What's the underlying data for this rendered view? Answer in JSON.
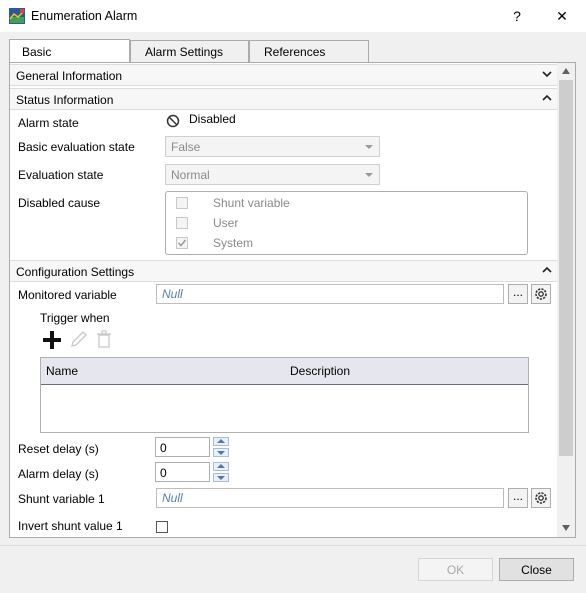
{
  "window": {
    "title": "Enumeration Alarm",
    "help": "?",
    "close": "✕"
  },
  "tabs": [
    {
      "label": "Basic"
    },
    {
      "label": "Alarm Settings"
    },
    {
      "label": "References"
    }
  ],
  "sections": {
    "general": "General Information",
    "status": "Status Information",
    "config": "Configuration Settings"
  },
  "status": {
    "alarm_state_label": "Alarm state",
    "alarm_state_value": "Disabled",
    "basic_eval_label": "Basic evaluation state",
    "basic_eval_value": "False",
    "eval_label": "Evaluation state",
    "eval_value": "Normal",
    "disabled_cause_label": "Disabled cause",
    "disabled_causes": [
      {
        "label": "Shunt variable",
        "checked": false
      },
      {
        "label": "User",
        "checked": false
      },
      {
        "label": "System",
        "checked": true
      }
    ]
  },
  "config": {
    "monitored_label": "Monitored variable",
    "monitored_value": "Null",
    "trigger_label": "Trigger when",
    "grid_headers": {
      "name": "Name",
      "description": "Description"
    },
    "reset_delay_label": "Reset delay (s)",
    "reset_delay_value": "0",
    "alarm_delay_label": "Alarm delay (s)",
    "alarm_delay_value": "0",
    "shunt_label": "Shunt variable 1",
    "shunt_value": "Null",
    "invert_label": "Invert shunt value 1",
    "browse": "..."
  },
  "footer": {
    "ok": "OK",
    "close": "Close"
  }
}
